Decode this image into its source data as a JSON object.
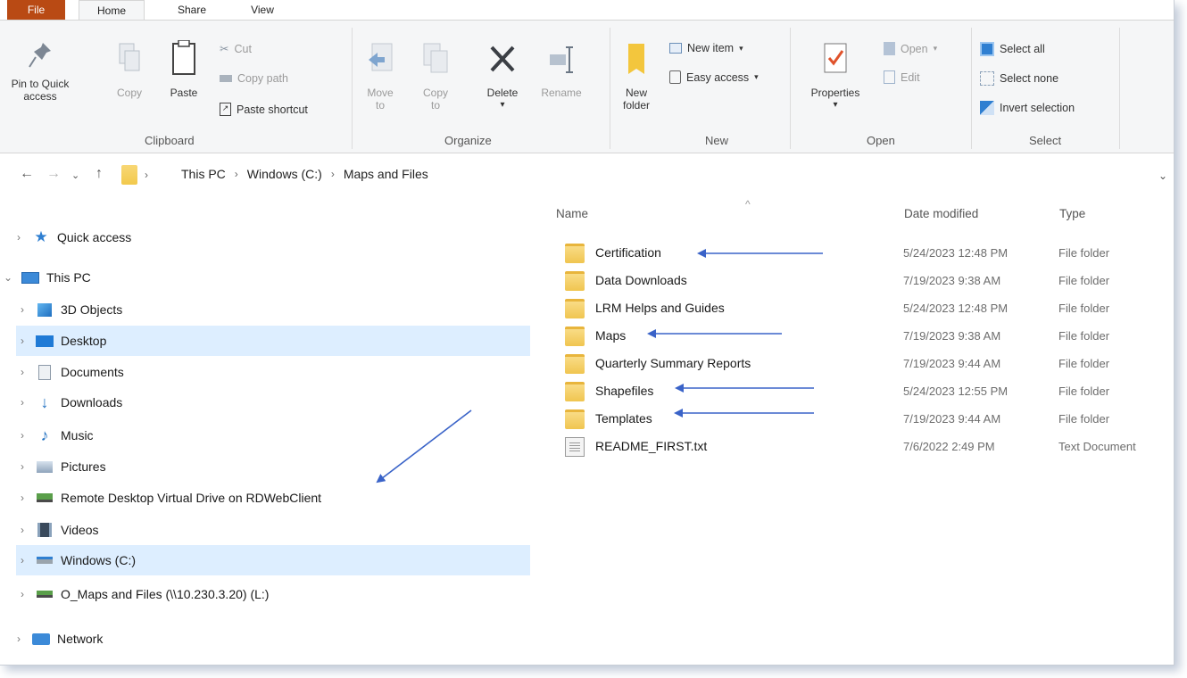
{
  "tabs": [
    "File",
    "Home",
    "Share",
    "View"
  ],
  "ribbon": {
    "clipboard": {
      "pin": "Pin to Quick access",
      "copy": "Copy",
      "paste": "Paste",
      "cut": "Cut",
      "copy_path": "Copy path",
      "paste_shortcut": "Paste shortcut",
      "label": "Clipboard"
    },
    "organize": {
      "move_to": "Move to",
      "copy_to": "Copy to",
      "delete": "Delete",
      "rename": "Rename",
      "label": "Organize"
    },
    "new": {
      "new_folder": "New folder",
      "new_item": "New item",
      "easy_access": "Easy access",
      "label": "New"
    },
    "open": {
      "properties": "Properties",
      "open": "Open",
      "edit": "Edit",
      "label": "Open"
    },
    "select": {
      "select_all": "Select all",
      "select_none": "Select none",
      "invert": "Invert selection",
      "label": "Select"
    }
  },
  "address": {
    "crumbs": [
      "This PC",
      "Windows (C:)",
      "Maps and Files"
    ]
  },
  "nav": {
    "quick_access": "Quick access",
    "this_pc": "This PC",
    "items": [
      "3D Objects",
      "Desktop",
      "Documents",
      "Downloads",
      "Music",
      "Pictures",
      "Remote Desktop Virtual Drive on RDWebClient",
      "Videos",
      "Windows (C:)",
      "O_Maps and Files (\\\\10.230.3.20) (L:)"
    ],
    "network": "Network"
  },
  "columns": {
    "name": "Name",
    "date": "Date modified",
    "type": "Type"
  },
  "files": [
    {
      "name": "Certification",
      "date": "5/24/2023 12:48 PM",
      "type": "File folder",
      "kind": "folder"
    },
    {
      "name": "Data Downloads",
      "date": "7/19/2023 9:38 AM",
      "type": "File folder",
      "kind": "folder"
    },
    {
      "name": "LRM Helps and Guides",
      "date": "5/24/2023 12:48 PM",
      "type": "File folder",
      "kind": "folder"
    },
    {
      "name": "Maps",
      "date": "7/19/2023 9:38 AM",
      "type": "File folder",
      "kind": "folder"
    },
    {
      "name": "Quarterly Summary Reports",
      "date": "7/19/2023 9:44 AM",
      "type": "File folder",
      "kind": "folder"
    },
    {
      "name": "Shapefiles",
      "date": "5/24/2023 12:55 PM",
      "type": "File folder",
      "kind": "folder"
    },
    {
      "name": "Templates",
      "date": "7/19/2023 9:44 AM",
      "type": "File folder",
      "kind": "folder"
    },
    {
      "name": "README_FIRST.txt",
      "date": "7/6/2022 2:49 PM",
      "type": "Text Document",
      "kind": "file"
    }
  ],
  "colors": {
    "file_tab": "#b94a14",
    "selection": "#ddeeff",
    "folder": "#f2c94c",
    "annotation_arrow": "#3a63c8"
  }
}
